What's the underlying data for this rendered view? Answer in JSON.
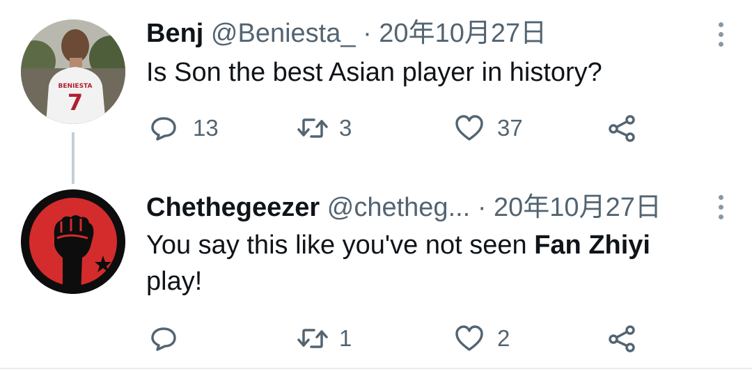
{
  "thread": [
    {
      "display_name": "Benj",
      "handle": "@Beniesta_",
      "separator": "·",
      "date": "20年10月27日",
      "text": "Is Son the best Asian player in history?",
      "avatar_jersey_name": "BENIESTA",
      "avatar_jersey_number": "7",
      "counts": {
        "replies": "13",
        "retweets": "3",
        "likes": "37"
      }
    },
    {
      "display_name": "Chethegeezer",
      "handle": "@chetheg...",
      "separator": "·",
      "date": "20年10月27日",
      "text_before": "You say this like you've not seen ",
      "text_bold": "Fan Zhiyi",
      "text_after": "play!",
      "counts": {
        "replies": "",
        "retweets": "1",
        "likes": "2"
      }
    }
  ],
  "icons": {
    "reply": "reply-icon",
    "retweet": "retweet-icon",
    "like": "heart-icon",
    "share": "share-icon",
    "more": "more-vertical-icon"
  },
  "colors": {
    "text_primary": "#0f1419",
    "text_secondary": "#536471",
    "thread_line": "#c4cfd6",
    "fist_badge_red": "#d42c2c"
  }
}
